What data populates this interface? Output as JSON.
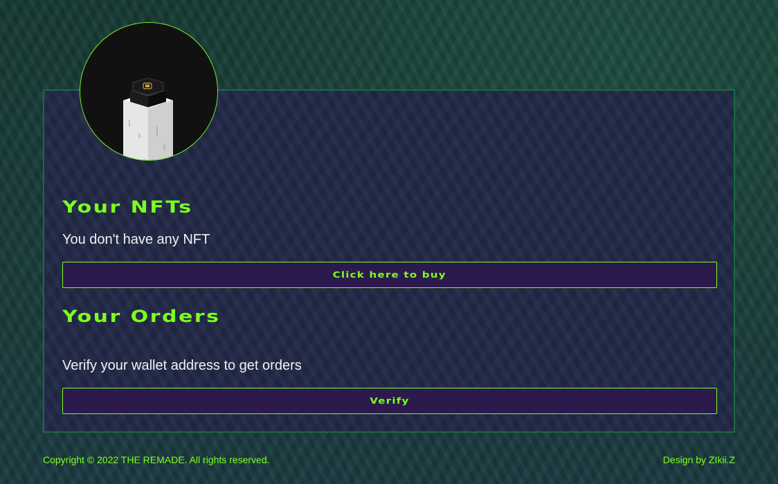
{
  "nfts_section": {
    "heading": "Your NFTs",
    "empty_message": "You don't have any NFT",
    "buy_button_label": "Click here to buy"
  },
  "orders_section": {
    "heading": "Your Orders",
    "message": "Verify your wallet address to get orders",
    "verify_button_label": "Verify"
  },
  "footer": {
    "copyright": "Copyright © 2022 THE REMADE. All rights reserved.",
    "credit": "Design by ZIkii.Z"
  },
  "icons": {
    "avatar": "nft-avatar-image"
  },
  "colors": {
    "accent": "#7dff1f",
    "button_bg": "#2c1a4d",
    "panel_bg": "#222947",
    "panel_border": "#1a6a44"
  }
}
